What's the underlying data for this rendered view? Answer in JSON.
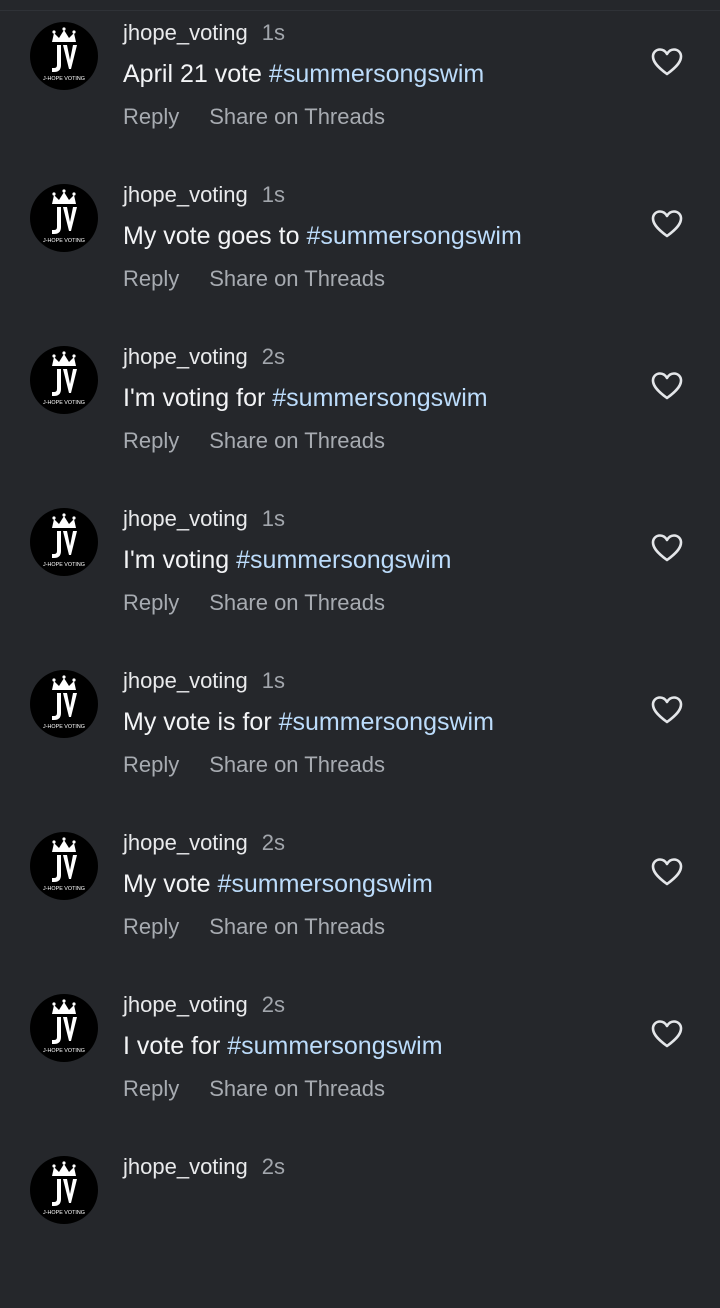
{
  "comments": [
    {
      "username": "jhope_voting",
      "time": "1s",
      "text": "April 21 vote ",
      "hashtag": "#summersongswim",
      "reply": "Reply",
      "share": "Share on Threads"
    },
    {
      "username": "jhope_voting",
      "time": "1s",
      "text": "My vote goes to ",
      "hashtag": "#summersongswim",
      "reply": "Reply",
      "share": "Share on Threads"
    },
    {
      "username": "jhope_voting",
      "time": "2s",
      "text": "I'm voting for ",
      "hashtag": "#summersongswim",
      "reply": "Reply",
      "share": "Share on Threads"
    },
    {
      "username": "jhope_voting",
      "time": "1s",
      "text": "I'm voting ",
      "hashtag": "#summersongswim",
      "reply": "Reply",
      "share": "Share on Threads"
    },
    {
      "username": "jhope_voting",
      "time": "1s",
      "text": "My vote is for ",
      "hashtag": "#summersongswim",
      "reply": "Reply",
      "share": "Share on Threads"
    },
    {
      "username": "jhope_voting",
      "time": "2s",
      "text": "My vote ",
      "hashtag": "#summersongswim",
      "reply": "Reply",
      "share": "Share on Threads"
    },
    {
      "username": "jhope_voting",
      "time": "2s",
      "text": "I vote for ",
      "hashtag": "#summersongswim",
      "reply": "Reply",
      "share": "Share on Threads"
    },
    {
      "username": "jhope_voting",
      "time": "2s"
    }
  ],
  "avatar": {
    "logo_text": "J-HOPE VOTING",
    "monogram": "JV"
  },
  "colors": {
    "background": "#25272b",
    "hashtag": "#bcdcfb",
    "muted": "#a7abb1",
    "text": "#f3f4f6"
  },
  "icons": {
    "like": "heart-outline-icon",
    "avatar": "crown-logo-icon"
  }
}
